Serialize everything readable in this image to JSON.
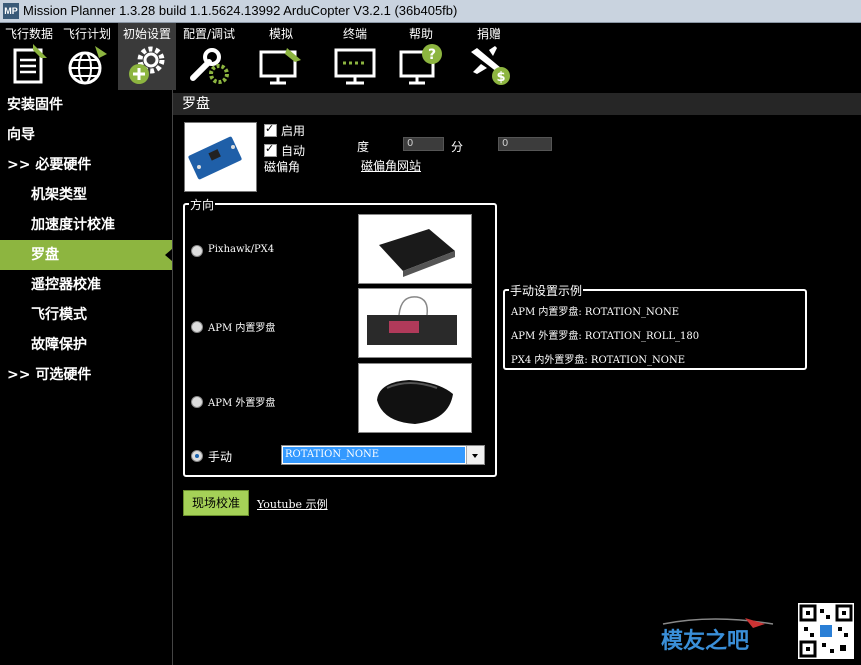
{
  "window": {
    "title": "Mission Planner 1.3.28 build 1.1.5624.13992 ArduCopter V3.2.1 (36b405fb)",
    "icon_text": "MP"
  },
  "toolbar": {
    "items": [
      {
        "label": "飞行数据",
        "icon": "clipboard-icon"
      },
      {
        "label": "飞行计划",
        "icon": "globe-icon"
      },
      {
        "label": "初始设置",
        "icon": "gear-plus-icon"
      },
      {
        "label": "配置/调试",
        "icon": "wrench-gear-icon"
      },
      {
        "label": "模拟",
        "icon": "monitor-plane-icon"
      },
      {
        "label": "终端",
        "icon": "terminal-icon"
      },
      {
        "label": "帮助",
        "icon": "help-monitor-icon"
      },
      {
        "label": "捐赠",
        "icon": "plane-dollar-icon"
      }
    ]
  },
  "sidebar": {
    "items": [
      {
        "label": "安装固件"
      },
      {
        "label": "向导"
      },
      {
        "label": ">> 必要硬件"
      },
      {
        "label": "机架类型"
      },
      {
        "label": "加速度计校准"
      },
      {
        "label": "罗盘"
      },
      {
        "label": "遥控器校准"
      },
      {
        "label": "飞行模式"
      },
      {
        "label": "故障保护"
      },
      {
        "label": ">> 可选硬件"
      }
    ]
  },
  "compass": {
    "header": "罗盘",
    "enable_label": "启用",
    "enable_checked": true,
    "auto_dec_label_1": "自动",
    "auto_dec_label_2": "磁偏角",
    "auto_checked": true,
    "degree_label": "度",
    "degree_value": "0",
    "minute_label": "分",
    "minute_value": "0",
    "dec_website_link": "磁偏角网站"
  },
  "orientation": {
    "title": "方向",
    "options": [
      {
        "label": "Pixhawk/PX4",
        "selected": false
      },
      {
        "label": "APM 内置罗盘",
        "selected": false
      },
      {
        "label": "APM 外置罗盘",
        "selected": false
      },
      {
        "label": "手动",
        "selected": true
      }
    ],
    "manual_value": "ROTATION_NONE"
  },
  "manual_example": {
    "title": "手动设置示例",
    "lines": [
      "APM 内置罗盘: ROTATION_NONE",
      "APM 外置罗盘: ROTATION_ROLL_180",
      "PX4 内外置罗盘: ROTATION_NONE"
    ]
  },
  "actions": {
    "live_calibration": "现场校准",
    "youtube_link": "Youtube 示例"
  },
  "watermark": {
    "text": "模友之吧"
  }
}
